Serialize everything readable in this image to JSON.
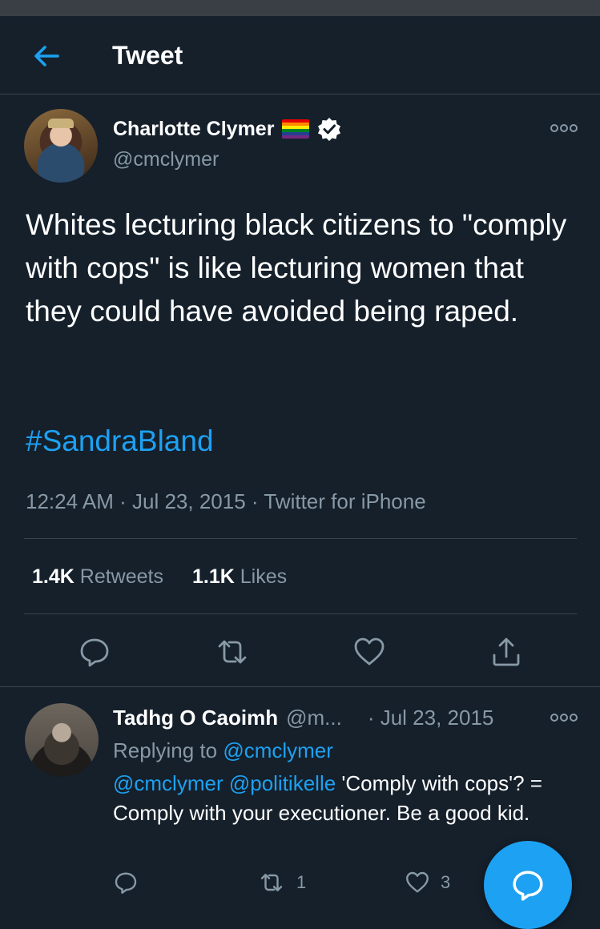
{
  "header": {
    "title": "Tweet"
  },
  "tweet": {
    "author_name": "Charlotte Clymer",
    "author_handle": "@cmclymer",
    "text": "Whites lecturing black citizens to \"comply with cops\" is like lecturing women that they could have avoided being raped.",
    "hashtag": "#SandraBland",
    "time": "12:24 AM",
    "date": "Jul 23, 2015",
    "separator": "·",
    "client": "Twitter for iPhone",
    "retweets_count": "1.4K",
    "retweets_label": "Retweets",
    "likes_count": "1.1K",
    "likes_label": "Likes"
  },
  "reply": {
    "author_name": "Tadhg O Caoimh",
    "author_handle": "@m...",
    "date": "· Jul 23, 2015",
    "replying_prefix": "Replying to",
    "replying_to": "@cmclymer",
    "mention1": "@cmclymer",
    "mention2": "@politikelle",
    "text": "'Comply with cops'? = Comply with your executioner. Be a good kid.",
    "retweet_count": "1",
    "like_count": "3"
  },
  "colors": {
    "background": "#15202b",
    "accent": "#1da1f2",
    "muted": "#8899a6",
    "divider": "#38444d"
  }
}
